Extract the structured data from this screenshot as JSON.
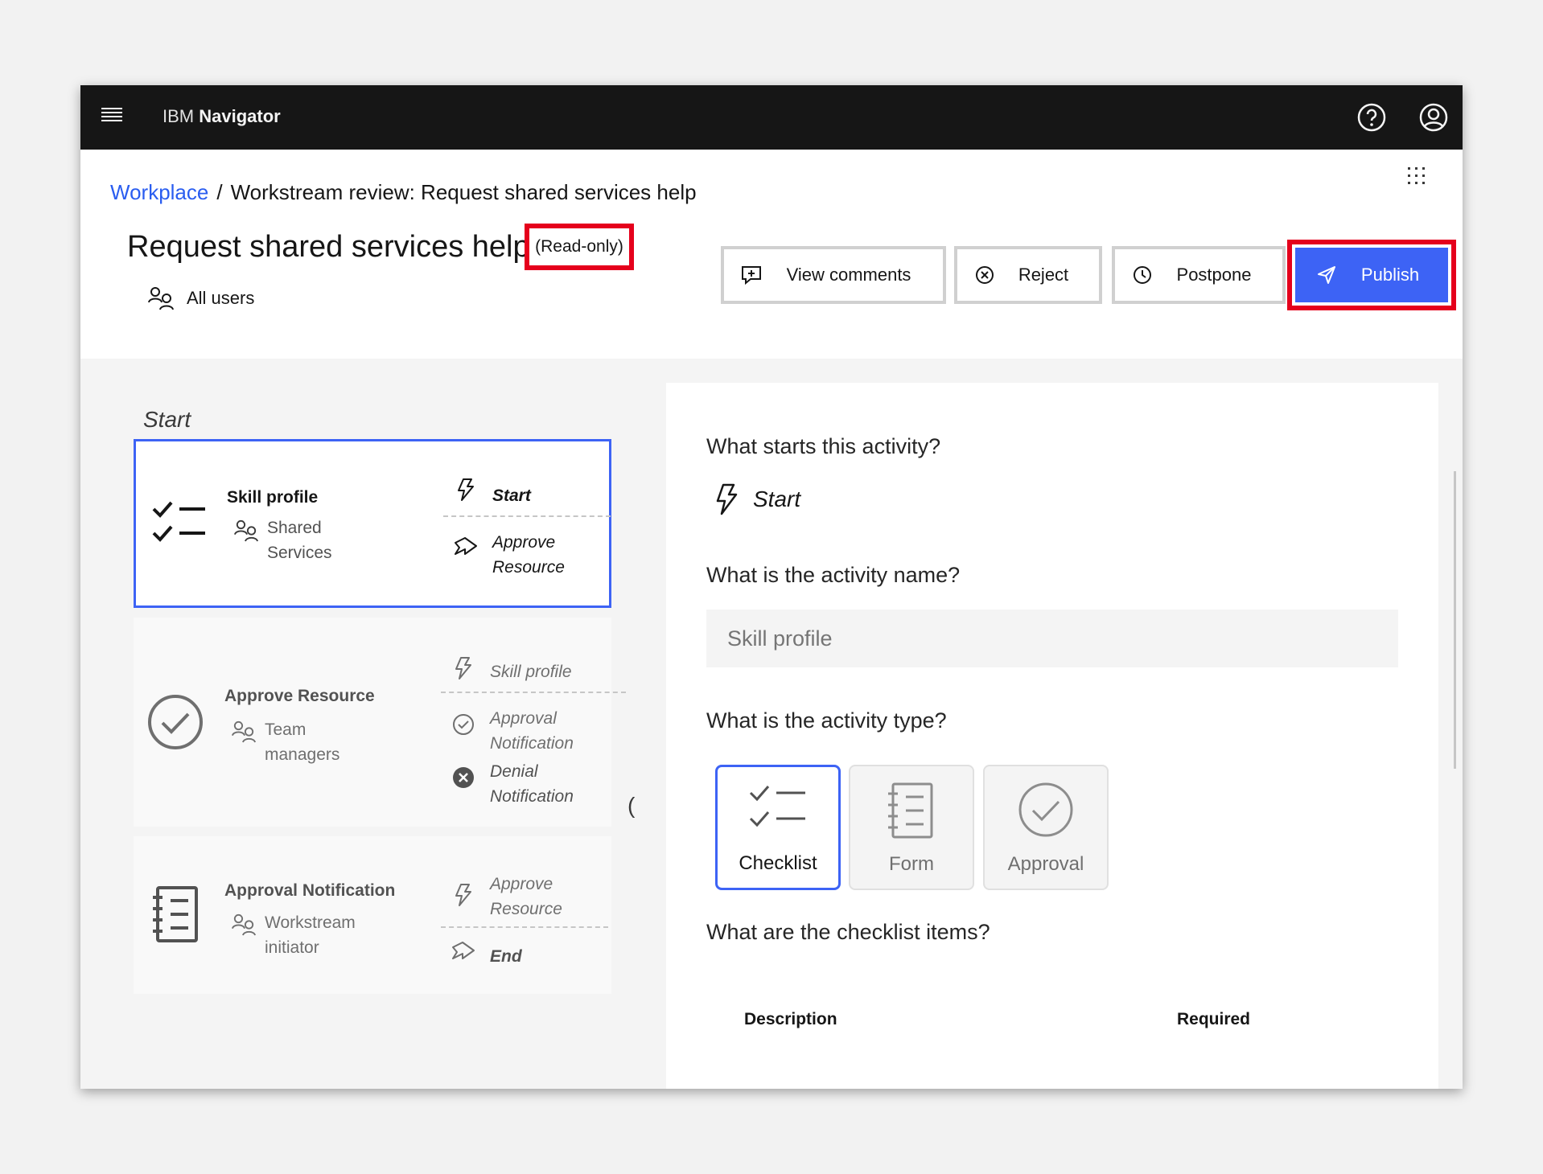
{
  "app": {
    "brand_light": "IBM",
    "brand_bold": "Navigator"
  },
  "breadcrumb": {
    "root": "Workplace",
    "separator": "/",
    "current": "Workstream review: Request shared services help"
  },
  "header": {
    "title": "Request shared services help",
    "status_badge": "(Read-only)",
    "audience": "All users"
  },
  "actions": {
    "view_comments": "View comments",
    "reject": "Reject",
    "postpone": "Postpone",
    "publish": "Publish"
  },
  "flow": {
    "section_label": "Start",
    "cards": [
      {
        "title": "Skill profile",
        "owner": "Shared Services",
        "trigger": "Start",
        "next": "Approve Resource",
        "icon": "checklist-icon"
      },
      {
        "title": "Approve Resource",
        "owner": "Team managers",
        "trigger": "Skill profile",
        "next_approve": "Approval Notification",
        "next_deny": "Denial Notification",
        "icon": "approval-icon"
      },
      {
        "title": "Approval Notification",
        "owner": "Workstream initiator",
        "trigger": "Approve Resource",
        "next": "End",
        "icon": "form-icon"
      }
    ],
    "collapse_glyph": "("
  },
  "details": {
    "q_start": "What starts this activity?",
    "start_value": "Start",
    "q_name": "What is the activity name?",
    "name_placeholder": "Skill profile",
    "q_type": "What is the activity type?",
    "types": [
      "Checklist",
      "Form",
      "Approval"
    ],
    "selected_type": "Checklist",
    "q_items": "What are the checklist items?",
    "col_description": "Description",
    "col_required": "Required"
  },
  "colors": {
    "primary": "#3d63f5",
    "highlight": "#e5001c",
    "topbar": "#161616"
  }
}
